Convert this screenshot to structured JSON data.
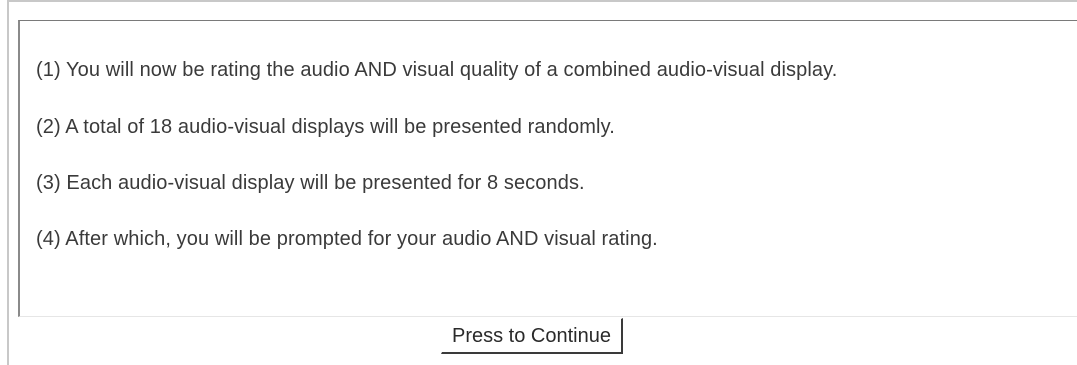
{
  "instructions": [
    "(1)  You will now be rating the audio AND visual quality of a combined audio-visual display.",
    "(2)  A total of 18 audio-visual displays will be presented randomly.",
    "(3)  Each audio-visual display will be presented for 8 seconds.",
    "(4)  After which, you will be prompted for your audio AND visual rating."
  ],
  "continue_button": {
    "label": "Press to Continue"
  }
}
